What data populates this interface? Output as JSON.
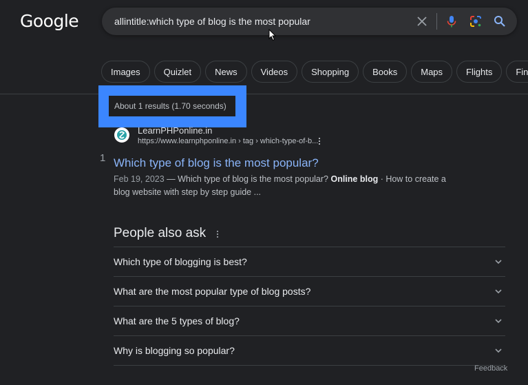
{
  "header": {
    "logo": "Google",
    "search": {
      "value": "allintitle:which type of blog is the most popular",
      "icons": [
        "clear-icon",
        "mic-icon",
        "lens-icon",
        "search-icon"
      ]
    }
  },
  "chips": [
    "Images",
    "Quizlet",
    "News",
    "Videos",
    "Shopping",
    "Books",
    "Maps",
    "Flights",
    "Finance"
  ],
  "stats": "About 1 results (1.70 seconds)",
  "result": {
    "index": "1",
    "site_name": "LearnPHPonline.in",
    "url": "https://www.learnphponline.in › tag › which-type-of-b...",
    "title": "Which type of blog is the most popular?",
    "date": "Feb 19, 2023",
    "snippet_part1": " — Which type of blog is the most popular? ",
    "snippet_bold": "Online blog",
    "snippet_part2": " · How to create a blog website with step by step guide ..."
  },
  "people_also_ask": {
    "title": "People also ask",
    "questions": [
      "Which type of blogging is best?",
      "What are the most popular type of blog posts?",
      "What are the 5 types of blog?",
      "Why is blogging so popular?"
    ],
    "feedback": "Feedback"
  },
  "colors": {
    "background": "#202124",
    "link": "#8ab4f8",
    "highlight": "#3b86ff"
  }
}
